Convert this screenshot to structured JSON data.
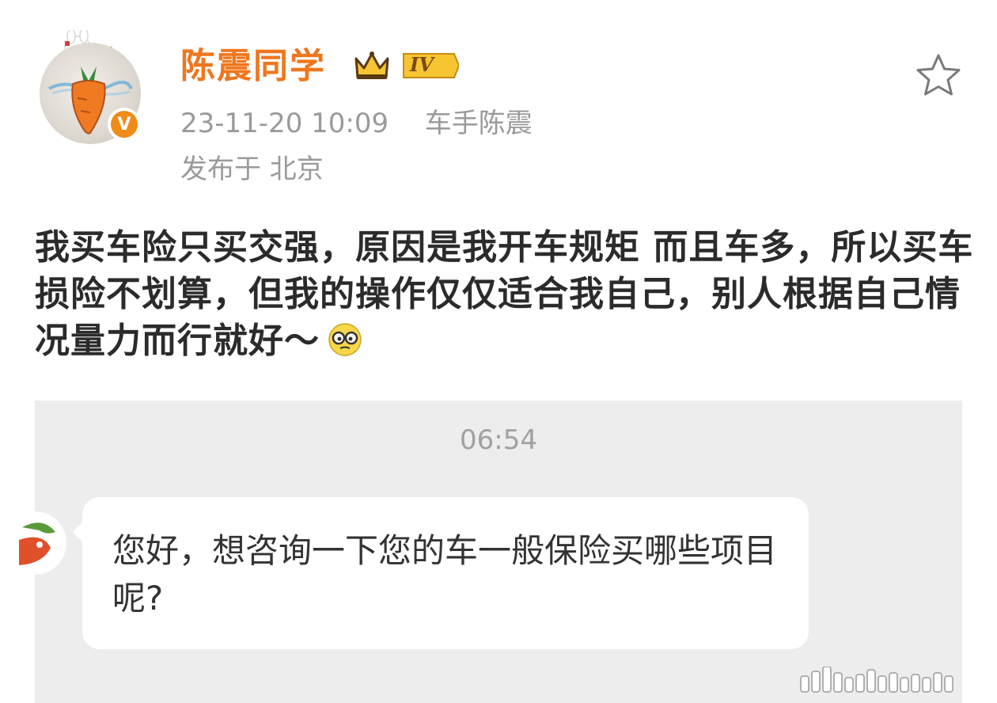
{
  "post": {
    "author": "陈震同学",
    "level": "IV",
    "date_time": "23-11-20 10:09",
    "source": "车手陈震",
    "location": "发布于 北京",
    "text": "我买车险只买交强，原因是我开车规矩 而且车多，所以买车损险不划算，但我的操作仅仅适合我自己，别人根据自己情况量力而行就好～"
  },
  "chat": {
    "time": "06:54",
    "message": "您好，想咨询一下您的车一般保险买哪些项目呢?"
  },
  "colors": {
    "username": "#f0761d",
    "badge": "#f08b18",
    "meta": "#9a9a9a",
    "chat_bg": "#ededed"
  },
  "icons": {
    "verified": "v-badge-icon",
    "level": "crown-level-icon",
    "favorite": "star-icon",
    "emoji": "glasses-emoji-icon"
  }
}
